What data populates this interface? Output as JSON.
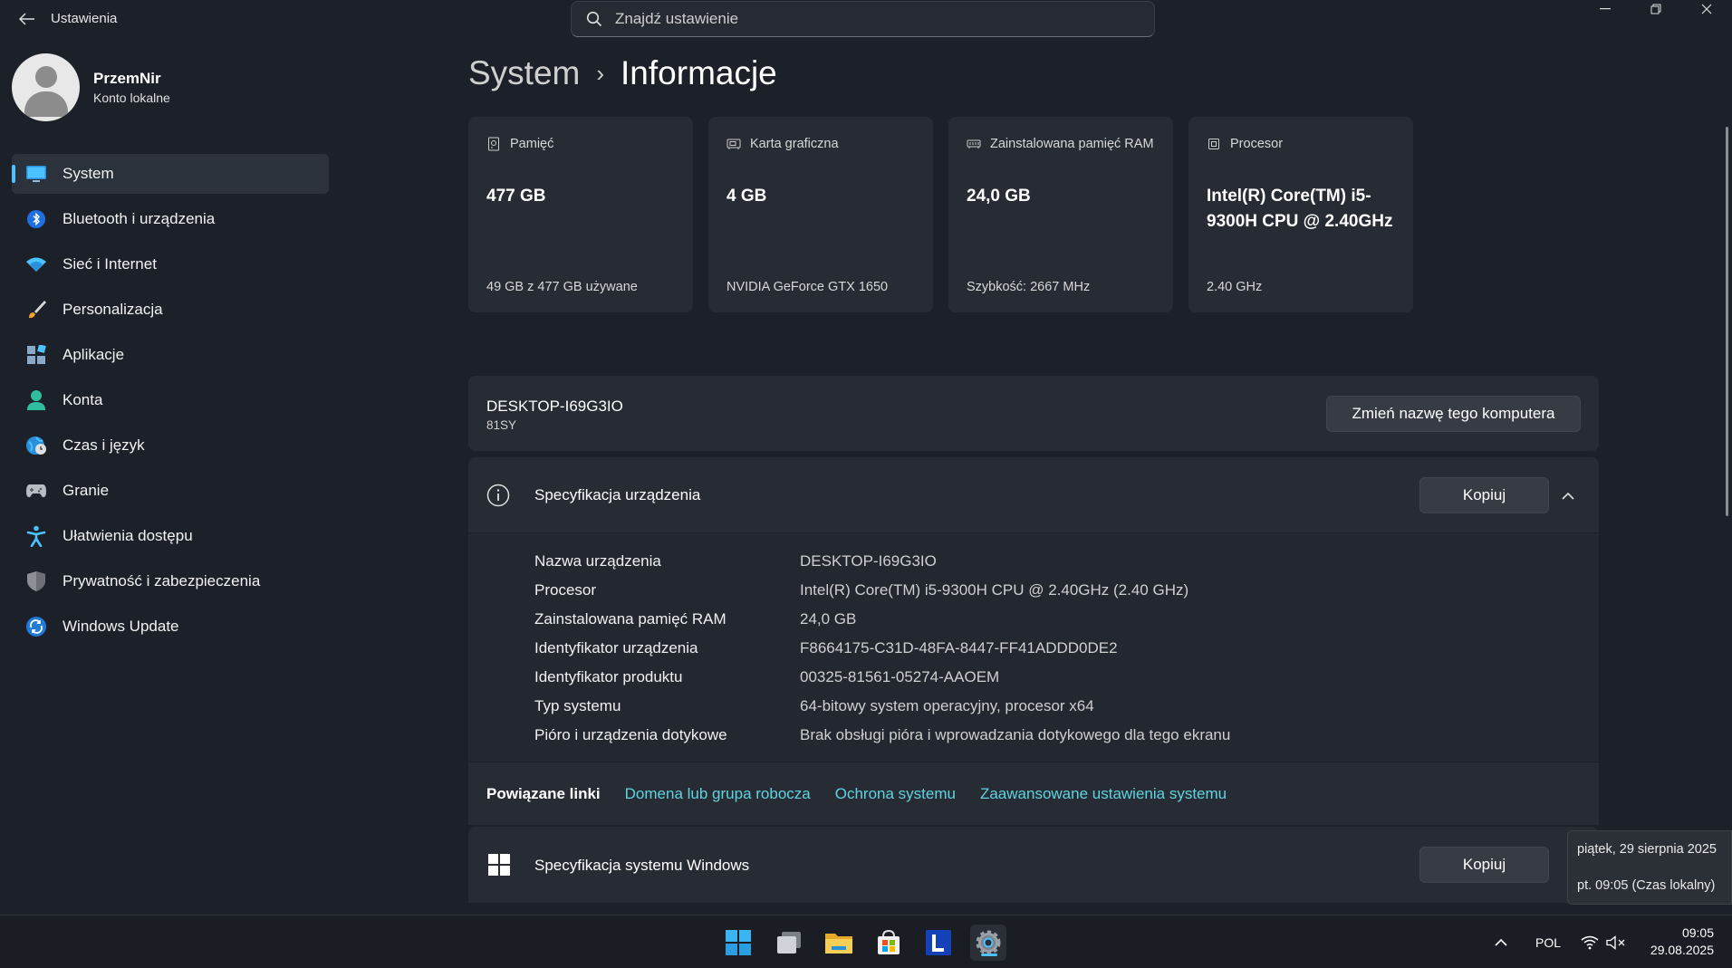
{
  "window": {
    "title": "Ustawienia",
    "search_placeholder": "Znajdź ustawienie"
  },
  "profile": {
    "name": "PrzemNir",
    "account_type": "Konto lokalne"
  },
  "sidebar": {
    "items": [
      {
        "label": "System",
        "icon": "system-monitor-icon",
        "active": true
      },
      {
        "label": "Bluetooth i urządzenia",
        "icon": "bluetooth-icon"
      },
      {
        "label": "Sieć i Internet",
        "icon": "wifi-icon"
      },
      {
        "label": "Personalizacja",
        "icon": "brush-icon"
      },
      {
        "label": "Aplikacje",
        "icon": "apps-icon"
      },
      {
        "label": "Konta",
        "icon": "person-icon"
      },
      {
        "label": "Czas i język",
        "icon": "globe-clock-icon"
      },
      {
        "label": "Granie",
        "icon": "gamepad-icon"
      },
      {
        "label": "Ułatwienia dostępu",
        "icon": "accessibility-icon"
      },
      {
        "label": "Prywatność i zabezpieczenia",
        "icon": "shield-icon"
      },
      {
        "label": "Windows Update",
        "icon": "update-icon"
      }
    ]
  },
  "breadcrumb": {
    "parent": "System",
    "separator": "›",
    "current": "Informacje"
  },
  "cards": [
    {
      "title": "Pamięć",
      "value": "477 GB",
      "footer": "49 GB z 477 GB używane",
      "icon": "storage-icon"
    },
    {
      "title": "Karta graficzna",
      "value": "4 GB",
      "footer": "NVIDIA GeForce GTX 1650",
      "icon": "gpu-icon"
    },
    {
      "title": "Zainstalowana pamięć RAM",
      "value": "24,0 GB",
      "footer": "Szybkość: 2667 MHz",
      "icon": "ram-icon"
    },
    {
      "title": "Procesor",
      "value": "Intel(R) Core(TM) i5-9300H CPU @ 2.40GHz",
      "footer": "2.40 GHz",
      "icon": "cpu-icon"
    }
  ],
  "device": {
    "name": "DESKTOP-I69G3IO",
    "model": "81SY",
    "rename_button": "Zmień nazwę tego komputera"
  },
  "device_spec": {
    "title": "Specyfikacja urządzenia",
    "copy_button": "Kopiuj",
    "rows": [
      {
        "label": "Nazwa urządzenia",
        "value": "DESKTOP-I69G3IO"
      },
      {
        "label": "Procesor",
        "value": "Intel(R) Core(TM) i5-9300H CPU @ 2.40GHz (2.40 GHz)"
      },
      {
        "label": "Zainstalowana pamięć RAM",
        "value": "24,0 GB"
      },
      {
        "label": "Identyfikator urządzenia",
        "value": "F8664175-C31D-48FA-8447-FF41ADDD0DE2"
      },
      {
        "label": "Identyfikator produktu",
        "value": "00325-81561-05274-AAOEM"
      },
      {
        "label": "Typ systemu",
        "value": "64-bitowy system operacyjny, procesor x64"
      },
      {
        "label": "Pióro i urządzenia dotykowe",
        "value": "Brak obsługi pióra i wprowadzania dotykowego dla tego ekranu"
      }
    ]
  },
  "related_links": {
    "title": "Powiązane linki",
    "links": [
      "Domena lub grupa robocza",
      "Ochrona systemu",
      "Zaawansowane ustawienia systemu"
    ]
  },
  "windows_spec": {
    "title": "Specyfikacja systemu Windows",
    "copy_button": "Kopiuj"
  },
  "tooltip": {
    "date_long": "piątek, 29 sierpnia 2025",
    "time_local": "pt. 09:05 (Czas lokalny)"
  },
  "taskbar": {
    "language": "POL",
    "time": "09:05",
    "date": "29.08.2025",
    "pinned": [
      "start-icon",
      "task-view-icon",
      "file-explorer-icon",
      "store-icon",
      "l-app-icon",
      "settings-icon"
    ],
    "accent_color": "#4cc2ff"
  },
  "colors": {
    "background": "#1c2129",
    "card": "#272c34",
    "link": "#5fd4e0",
    "accent": "#4cc2ff"
  }
}
